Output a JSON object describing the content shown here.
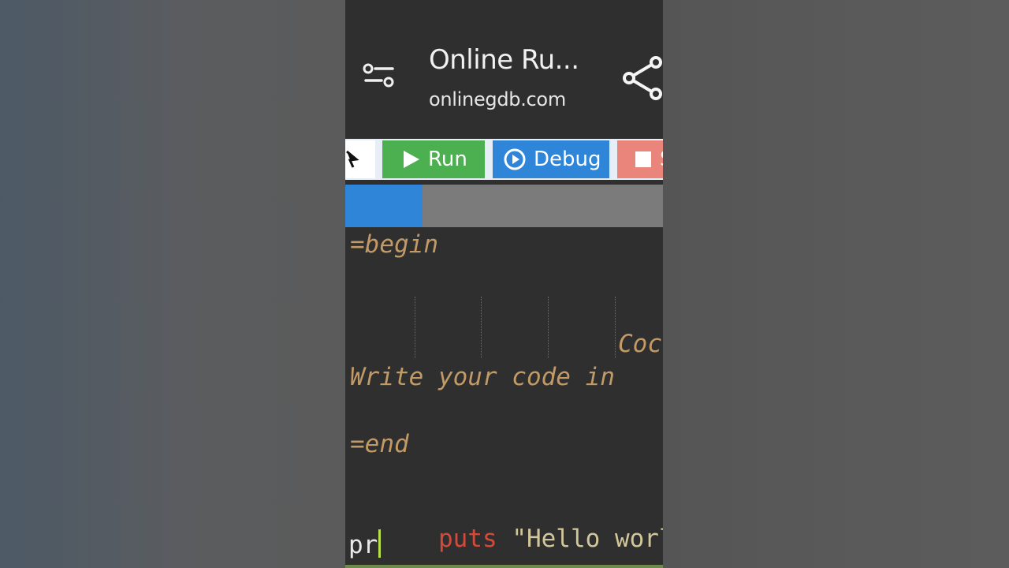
{
  "header": {
    "title": "Online Ru...",
    "url": "onlinegdb.com",
    "icons": [
      "tune-icon",
      "share-icon"
    ]
  },
  "toolbar": {
    "run_label": "Run",
    "debug_label": "Debug",
    "stop_label": "S",
    "colors": {
      "run": "#4caf50",
      "debug": "#2f86d8",
      "stop": "#e9857a"
    }
  },
  "editor": {
    "lines": {
      "begin": "=begin",
      "code_fragment": "Coc",
      "write_line": "Write your code in",
      "end": "=end",
      "puts_keyword": "puts",
      "puts_string": "\"Hello world\"",
      "typing": "pr"
    }
  }
}
